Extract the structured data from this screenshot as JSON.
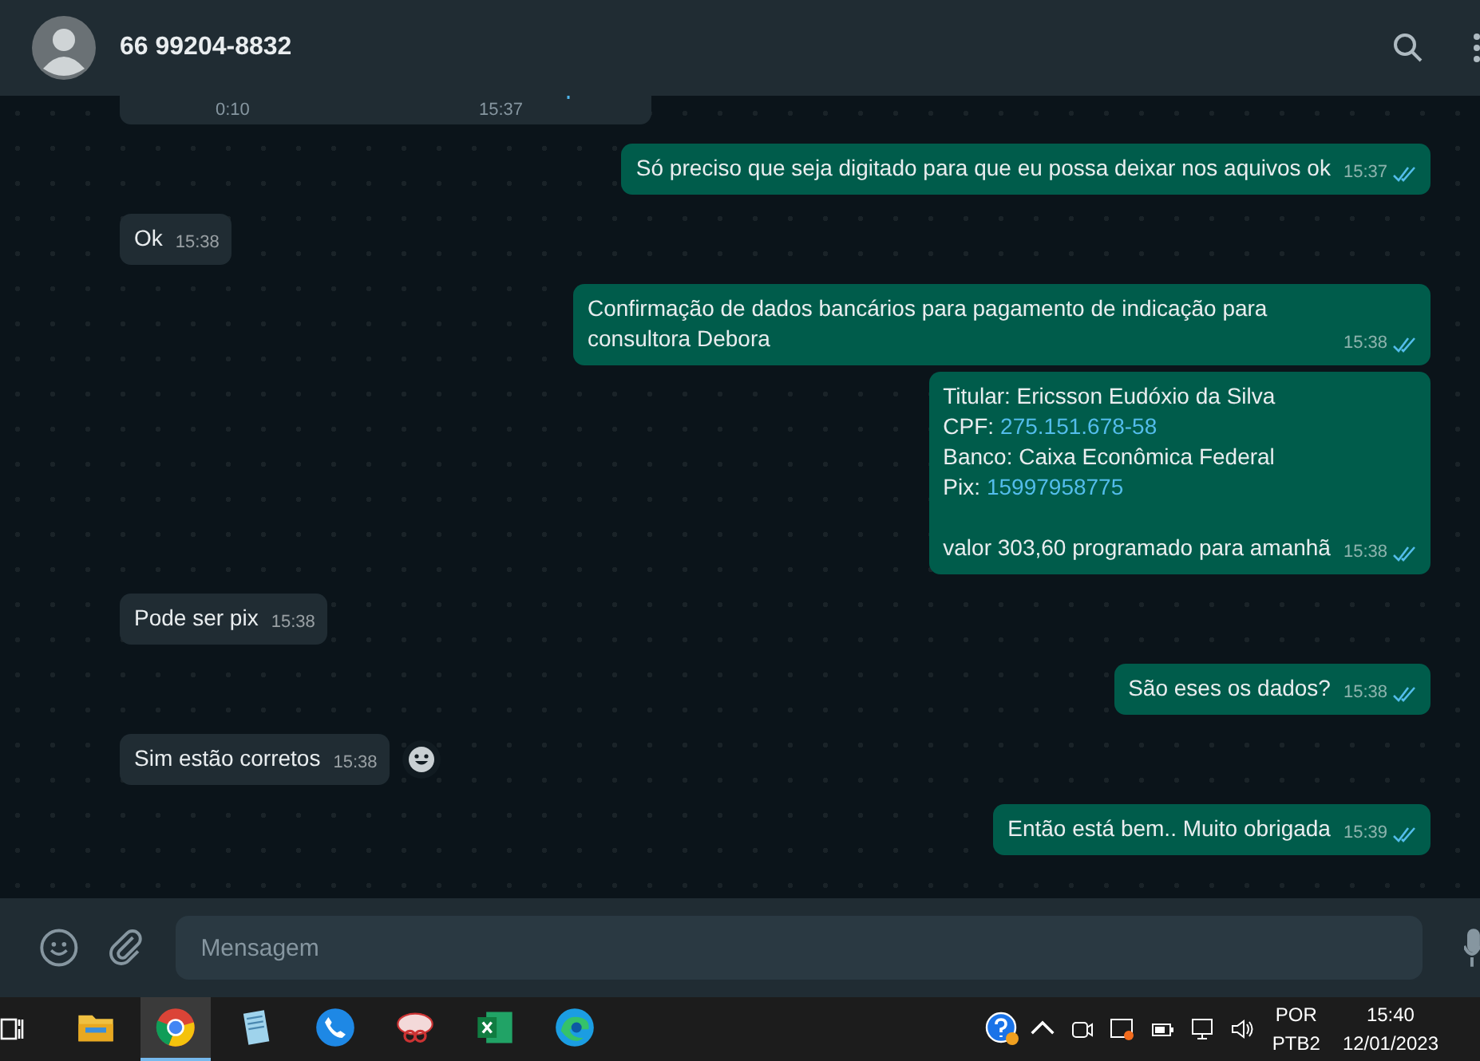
{
  "header": {
    "contact": "66 99204-8832"
  },
  "audio": {
    "duration": "0:10",
    "time": "15:37"
  },
  "messages": [
    {
      "kind": "out",
      "lines": [
        {
          "text": "Só preciso que seja digitado para que eu possa deixar nos aquivos ok"
        }
      ],
      "time": "15:37",
      "read": true
    },
    {
      "kind": "in",
      "lines": [
        {
          "text": "Ok"
        }
      ],
      "time": "15:38"
    },
    {
      "kind": "out",
      "lines": [
        {
          "text": "Confirmação de dados bancários para pagamento de indicação para consultora Debora"
        }
      ],
      "time": "15:38",
      "read": true
    },
    {
      "kind": "out",
      "lines": [
        {
          "text": "Titular: Ericsson Eudóxio da Silva"
        },
        {
          "text": "CPF:",
          "link": "275.151.678-58"
        },
        {
          "text": "Banco: Caixa Econômica Federal"
        },
        {
          "text": "Pix:",
          "link": "15997958775"
        },
        {
          "text": "valor 303,60 programado para amanhã",
          "spacer_before": true
        }
      ],
      "time": "15:38",
      "read": true
    },
    {
      "kind": "in",
      "lines": [
        {
          "text": "Pode ser pix"
        }
      ],
      "time": "15:38"
    },
    {
      "kind": "out",
      "lines": [
        {
          "text": "São eses os dados?"
        }
      ],
      "time": "15:38",
      "read": true
    },
    {
      "kind": "in",
      "lines": [
        {
          "text": "Sim estão corretos"
        }
      ],
      "time": "15:38",
      "reaction": true
    },
    {
      "kind": "out",
      "lines": [
        {
          "text": "Então está bem.. Muito obrigada"
        }
      ],
      "time": "15:39",
      "read": true
    }
  ],
  "composer": {
    "placeholder": "Mensagem"
  },
  "taskbar": {
    "apps": [
      {
        "kind": "folder",
        "selected": false
      },
      {
        "kind": "chrome",
        "selected": true
      },
      {
        "kind": "notepad",
        "selected": false
      },
      {
        "kind": "phone",
        "selected": false
      },
      {
        "kind": "snip",
        "selected": false
      },
      {
        "kind": "excel",
        "selected": false
      },
      {
        "kind": "edge",
        "selected": false
      }
    ],
    "language": "POR",
    "layout": "PTB2",
    "time": "15:40",
    "date": "12/01/2023"
  }
}
